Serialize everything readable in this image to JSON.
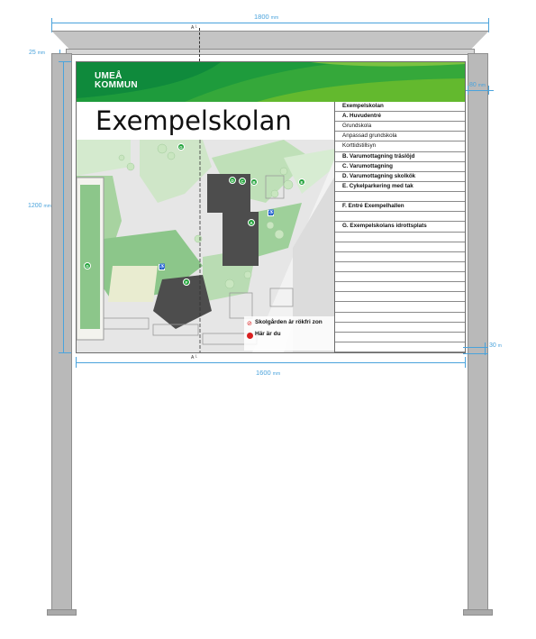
{
  "dimensions": {
    "overall_width": "1800",
    "sign_width": "1600",
    "height": "1200",
    "top_beam": "25",
    "post_width": "80",
    "bottom_gap": "30",
    "unit_overall": "mm",
    "unit_sign": "mm",
    "unit_height": "mm",
    "unit_top_beam": "mm",
    "unit_post": "mm",
    "unit_bottom": "m",
    "section_marker": "A"
  },
  "sign": {
    "logo_line1": "UMEÅ",
    "logo_line2": "KOMMUN",
    "title": "Exempelskolan",
    "legend": [
      {
        "text": "Exempelskolan",
        "bold": true
      },
      {
        "text": "A.      Huvudentré",
        "bold": true
      },
      {
        "text": "Grundskola",
        "bold": false
      },
      {
        "text": "Anpassad grundskola",
        "bold": false
      },
      {
        "text": "Korttidstillsyn",
        "bold": false
      },
      {
        "text": "B. Varumottagning träslöjd",
        "bold": true
      },
      {
        "text": "C. Varumottagning",
        "bold": true
      },
      {
        "text": "D. Varumottagning skolkök",
        "bold": true
      },
      {
        "text": "E. Cykelparkering med tak",
        "bold": true
      },
      {
        "text": "",
        "bold": false
      },
      {
        "text": "F. Entré Exempelhallen",
        "bold": true
      },
      {
        "text": "",
        "bold": false
      },
      {
        "text": "G. Exempelskolans idrottsplats",
        "bold": true
      },
      {
        "text": "",
        "bold": false
      },
      {
        "text": "",
        "bold": false
      },
      {
        "text": "",
        "bold": false
      },
      {
        "text": "",
        "bold": false
      },
      {
        "text": "",
        "bold": false
      },
      {
        "text": "",
        "bold": false
      },
      {
        "text": "",
        "bold": false
      },
      {
        "text": "",
        "bold": false
      },
      {
        "text": "",
        "bold": false
      },
      {
        "text": "",
        "bold": false
      },
      {
        "text": "",
        "bold": false
      },
      {
        "text": "",
        "bold": false
      }
    ],
    "map_labels": {
      "smoke_free": "Skolgården är rökfri zon",
      "you_are_here": "Här är du"
    },
    "markers": [
      "A",
      "B",
      "C",
      "D",
      "E",
      "F",
      "G"
    ]
  },
  "colors": {
    "brand_green": "#2f9e3a",
    "dark_green": "#0f8a3c",
    "light_green": "#8fc96b",
    "dimension_blue": "#4aa3dc",
    "post_gray": "#b9b9b9",
    "building_gray": "#4d4d4d",
    "here_red": "#d92020"
  }
}
